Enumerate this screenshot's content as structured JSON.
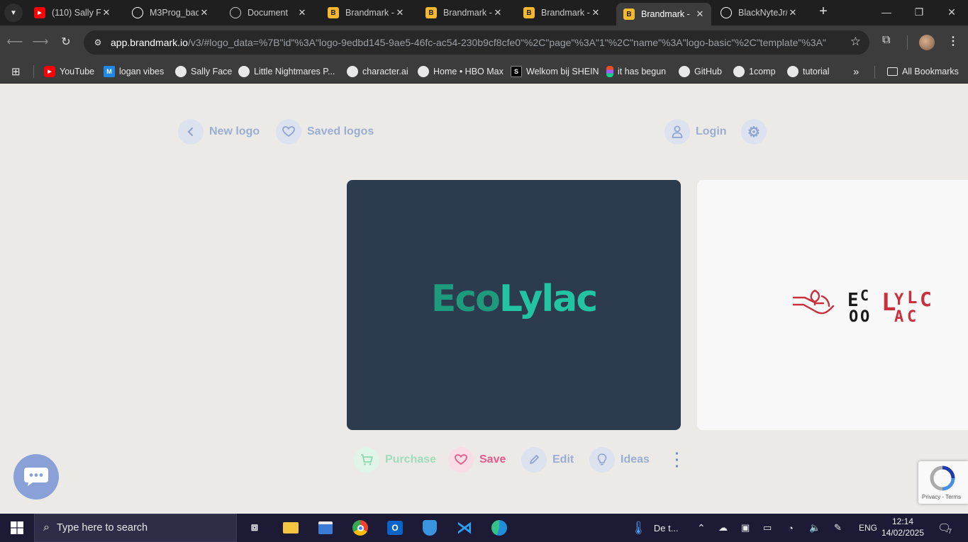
{
  "browser": {
    "tabs": [
      {
        "title": "(110) Sally Fa",
        "favicon": "youtube-icon",
        "color": "#ff0000"
      },
      {
        "title": "M3Prog_bac",
        "favicon": "github-icon",
        "color": "#ffffff"
      },
      {
        "title": "Document",
        "favicon": "globe-icon",
        "color": "#c8c8c8"
      },
      {
        "title": "Brandmark -",
        "favicon": "brandmark-icon",
        "color": "#f5b82e"
      },
      {
        "title": "Brandmark -",
        "favicon": "brandmark-icon",
        "color": "#f5b82e"
      },
      {
        "title": "Brandmark -",
        "favicon": "brandmark-icon",
        "color": "#f5b82e"
      },
      {
        "title": "Brandmark -",
        "favicon": "brandmark-icon",
        "color": "#f5b82e"
      },
      {
        "title": "BlackNyteJr/",
        "favicon": "github-icon",
        "color": "#ffffff"
      }
    ],
    "active_tab_index": 6,
    "url_host": "app.brandmark.io",
    "url_rest": "/v3/#logo_data=%7B\"id\"%3A\"logo-9edbd145-9ae5-46fc-ac54-230b9cf8cfe0\"%2C\"page\"%3A\"1\"%2C\"name\"%3A\"logo-basic\"%2C\"template\"%3A\"L...",
    "bookmarks": [
      {
        "label": "YouTube",
        "icon": "youtube-icon",
        "color": "#ff0000"
      },
      {
        "label": "logan vibes",
        "icon": "m-icon",
        "color": "#1e88e5"
      },
      {
        "label": "Sally Face",
        "icon": "skull-icon",
        "color": "#e8e8e8"
      },
      {
        "label": "Little Nightmares P...",
        "icon": "globe-icon",
        "color": "#e8e8e8"
      },
      {
        "label": "character.ai",
        "icon": "globe-icon",
        "color": "#e8e8e8"
      },
      {
        "label": "Home • HBO Max",
        "icon": "globe-icon",
        "color": "#e8e8e8"
      },
      {
        "label": "Welkom bij SHEIN",
        "icon": "shein-icon",
        "color": "#000000"
      },
      {
        "label": "it has begun",
        "icon": "figma-icon",
        "color": "#f24e1e"
      },
      {
        "label": "GitHub",
        "icon": "github-icon",
        "color": "#e8e8e8"
      },
      {
        "label": "1comp",
        "icon": "globe-icon",
        "color": "#e8e8e8"
      },
      {
        "label": "tutorial",
        "icon": "globe-icon",
        "color": "#e8e8e8"
      }
    ],
    "all_bookmarks_label": "All Bookmarks"
  },
  "page": {
    "nav": {
      "new_logo": "New logo",
      "saved_logos": "Saved logos",
      "login": "Login"
    },
    "logo_preview": {
      "part1": "Eco",
      "part2": "Lylac",
      "colors": {
        "background": "#2d3b4f",
        "eco": "#1e9a7c",
        "lylac": "#22c4a3"
      }
    },
    "alt_logo": {
      "eco_letters": [
        "E",
        "C",
        "O"
      ],
      "lylac_letters": [
        "L",
        "Y",
        "L",
        "A",
        "C"
      ],
      "colors": {
        "eco": "#1a1a1a",
        "lylac": "#c8303e",
        "icon": "#c8303e"
      }
    },
    "actions": {
      "purchase": "Purchase",
      "save": "Save",
      "edit": "Edit",
      "ideas": "Ideas"
    },
    "recaptcha_terms": "Privacy - Terms"
  },
  "taskbar": {
    "search_placeholder": "Type here to search",
    "weather": "De t...",
    "language": "ENG",
    "time": "12:14",
    "date": "14/02/2025",
    "notifications": "7"
  }
}
